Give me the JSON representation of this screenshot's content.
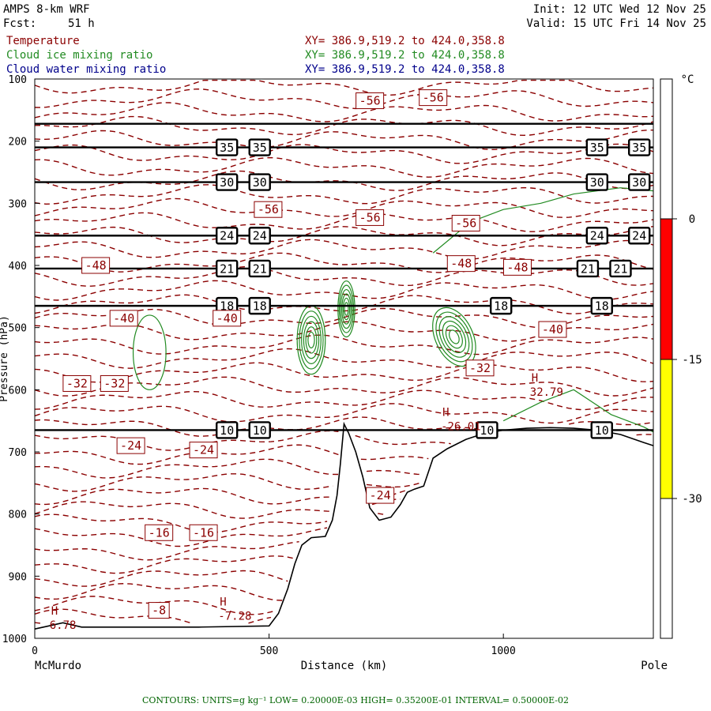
{
  "header": {
    "model": "AMPS 8-km WRF",
    "forecast_label": "Fcst:",
    "forecast_hours": "51 h",
    "init": "Init: 12 UTC Wed 12 Nov 25",
    "valid": "Valid: 15 UTC Fri 14 Nov 25"
  },
  "fields": [
    {
      "name": "Temperature",
      "xy": "XY= 386.9,519.2 to 424.0,358.8",
      "color": "#8b0000"
    },
    {
      "name": "Cloud ice mixing ratio",
      "xy": "XY= 386.9,519.2 to 424.0,358.8",
      "color": "#228b22"
    },
    {
      "name": "Cloud water mixing ratio",
      "xy": "XY= 386.9,519.2 to 424.0,358.8",
      "color": "#00008b"
    }
  ],
  "footer": "CONTOURS:  UNITS=g kg⁻¹  LOW= 0.20000E-03  HIGH= 0.35200E-01  INTERVAL=  0.50000E-02",
  "colorbar": {
    "unit": "°C",
    "ticks": [
      "0",
      "-15",
      "-30"
    ],
    "segments": [
      {
        "from": 0,
        "to": -15,
        "color": "#ff0000"
      },
      {
        "from": -15,
        "to": -30,
        "color": "#ffff00"
      }
    ]
  },
  "chart_data": {
    "type": "line",
    "title": "",
    "xlabel": "Distance (km)",
    "ylabel": "Pressure (hPa)",
    "xlim": [
      0,
      1320
    ],
    "ylim": [
      1000,
      100
    ],
    "x_ticks": [
      "0",
      "500",
      "1000"
    ],
    "y_ticks": [
      "100",
      "200",
      "300",
      "400",
      "500",
      "600",
      "700",
      "800",
      "900",
      "1000"
    ],
    "x_endpoint_labels": {
      "left": "McMurdo",
      "right": "Pole"
    },
    "terrain": [
      [
        0,
        985
      ],
      [
        30,
        980
      ],
      [
        60,
        975
      ],
      [
        100,
        982
      ],
      [
        200,
        982
      ],
      [
        350,
        982
      ],
      [
        500,
        980
      ],
      [
        520,
        960
      ],
      [
        540,
        920
      ],
      [
        555,
        880
      ],
      [
        570,
        850
      ],
      [
        590,
        838
      ],
      [
        620,
        836
      ],
      [
        635,
        810
      ],
      [
        645,
        770
      ],
      [
        652,
        720
      ],
      [
        660,
        655
      ],
      [
        670,
        670
      ],
      [
        685,
        700
      ],
      [
        700,
        740
      ],
      [
        715,
        790
      ],
      [
        735,
        810
      ],
      [
        760,
        805
      ],
      [
        780,
        785
      ],
      [
        795,
        765
      ],
      [
        810,
        760
      ],
      [
        830,
        755
      ],
      [
        850,
        710
      ],
      [
        880,
        695
      ],
      [
        920,
        680
      ],
      [
        960,
        670
      ],
      [
        1000,
        665
      ],
      [
        1050,
        662
      ],
      [
        1100,
        661
      ],
      [
        1150,
        662
      ],
      [
        1200,
        665
      ],
      [
        1250,
        672
      ],
      [
        1300,
        685
      ],
      [
        1320,
        690
      ]
    ],
    "bold_contours": [
      {
        "pressure": 172,
        "labels": []
      },
      {
        "pressure": 210,
        "labels": [
          {
            "x": 410,
            "text": "35"
          },
          {
            "x": 480,
            "text": "35"
          },
          {
            "x": 1200,
            "text": "35"
          },
          {
            "x": 1290,
            "text": "35"
          }
        ]
      },
      {
        "pressure": 266,
        "labels": [
          {
            "x": 410,
            "text": "30"
          },
          {
            "x": 480,
            "text": "30"
          },
          {
            "x": 1200,
            "text": "30"
          },
          {
            "x": 1290,
            "text": "30"
          }
        ]
      },
      {
        "pressure": 352,
        "labels": [
          {
            "x": 410,
            "text": "24"
          },
          {
            "x": 480,
            "text": "24"
          },
          {
            "x": 1200,
            "text": "24"
          },
          {
            "x": 1290,
            "text": "24"
          }
        ]
      },
      {
        "pressure": 405,
        "labels": [
          {
            "x": 410,
            "text": "21"
          },
          {
            "x": 480,
            "text": "21"
          },
          {
            "x": 1180,
            "text": "21"
          },
          {
            "x": 1250,
            "text": "21"
          }
        ]
      },
      {
        "pressure": 465,
        "labels": [
          {
            "x": 410,
            "text": "18"
          },
          {
            "x": 480,
            "text": "18"
          },
          {
            "x": 995,
            "text": "18"
          },
          {
            "x": 1210,
            "text": "18"
          }
        ]
      },
      {
        "pressure": 665,
        "labels": [
          {
            "x": 410,
            "text": "10"
          },
          {
            "x": 480,
            "text": "10"
          },
          {
            "x": 965,
            "text": "10"
          },
          {
            "x": 1210,
            "text": "10"
          }
        ]
      }
    ],
    "temperature_labels": [
      {
        "x": 715,
        "p": 135,
        "text": "-56"
      },
      {
        "x": 850,
        "p": 130,
        "text": "-56"
      },
      {
        "x": 498,
        "p": 310,
        "text": "-56"
      },
      {
        "x": 715,
        "p": 323,
        "text": "-56"
      },
      {
        "x": 920,
        "p": 332,
        "text": "-56"
      },
      {
        "x": 130,
        "p": 400,
        "text": "-48"
      },
      {
        "x": 910,
        "p": 397,
        "text": "-48"
      },
      {
        "x": 1030,
        "p": 403,
        "text": "-48"
      },
      {
        "x": 190,
        "p": 485,
        "text": "-40"
      },
      {
        "x": 410,
        "p": 485,
        "text": "-40"
      },
      {
        "x": 1105,
        "p": 503,
        "text": "-40"
      },
      {
        "x": 90,
        "p": 590,
        "text": "-32"
      },
      {
        "x": 170,
        "p": 590,
        "text": "-32"
      },
      {
        "x": 950,
        "p": 565,
        "text": "-32"
      },
      {
        "x": 205,
        "p": 690,
        "text": "-24"
      },
      {
        "x": 360,
        "p": 697,
        "text": "-24"
      },
      {
        "x": 737,
        "p": 770,
        "text": "-24"
      },
      {
        "x": 265,
        "p": 830,
        "text": "-16"
      },
      {
        "x": 360,
        "p": 830,
        "text": "-16"
      },
      {
        "x": 265,
        "p": 955,
        "text": "-8"
      }
    ],
    "temperature_isotherm_levels": [
      -8,
      -16,
      -24,
      -32,
      -40,
      -48,
      -56
    ],
    "extrema": [
      {
        "x": 35,
        "p": 985,
        "mark": "H",
        "value": "6.78"
      },
      {
        "x": 395,
        "p": 970,
        "mark": "H",
        "value": "-7.28"
      },
      {
        "x": 870,
        "p": 665,
        "mark": "H",
        "value": "-26.01"
      },
      {
        "x": 1060,
        "p": 610,
        "mark": "H",
        "value": "32.79"
      }
    ],
    "cloud_ice_cores": [
      {
        "x": 590,
        "p": 520,
        "rx": 30,
        "rp": 55,
        "rings": 6
      },
      {
        "x": 665,
        "p": 470,
        "rx": 18,
        "rp": 45,
        "rings": 6
      },
      {
        "x": 895,
        "p": 515,
        "rx": 40,
        "rp": 50,
        "rings": 6
      },
      {
        "x": 245,
        "p": 540,
        "rx": 35,
        "rp": 60,
        "rings": 1
      }
    ]
  }
}
